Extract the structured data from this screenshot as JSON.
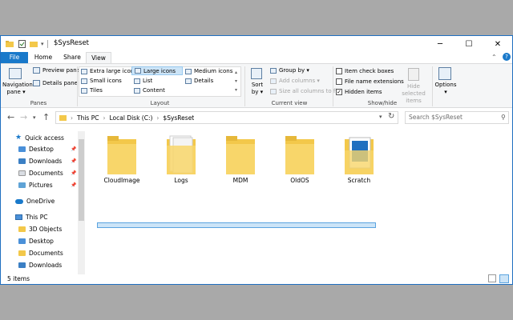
{
  "window": {
    "title": "$SysReset"
  },
  "title_controls": {
    "minimize": "─",
    "maximize": "☐",
    "close": "✕"
  },
  "tabs": {
    "file": "File",
    "home": "Home",
    "share": "Share",
    "view": "View"
  },
  "ribbon": {
    "panes": {
      "navigation_pane": "Navigation",
      "navigation_pane_2": "pane ▾",
      "preview_pane": "Preview pane",
      "details_pane": "Details pane",
      "label": "Panes"
    },
    "layout": {
      "extra_large": "Extra large icons",
      "large": "Large icons",
      "medium": "Medium icons",
      "small": "Small icons",
      "list": "List",
      "details": "Details",
      "tiles": "Tiles",
      "content": "Content",
      "label": "Layout",
      "selected": "Large icons"
    },
    "current_view": {
      "sort_by": "Sort",
      "sort_by_2": "by ▾",
      "group_by": "Group by ▾",
      "add_columns": "Add columns ▾",
      "size_columns": "Size all columns to fit",
      "label": "Current view"
    },
    "show_hide": {
      "item_check_boxes": "Item check boxes",
      "file_name_extensions": "File name extensions",
      "hidden_items": "Hidden items",
      "hidden_items_checked": true,
      "hide_selected": "Hide selected",
      "hide_selected_2": "items",
      "label": "Show/hide"
    },
    "options": {
      "label": "Options",
      "caret": "▾"
    }
  },
  "address": {
    "crumbs": [
      "This PC",
      "Local Disk (C:)",
      "$SysReset"
    ],
    "separator": "›",
    "search_placeholder": "Search $SysReset"
  },
  "sidebar": {
    "quick_access": "Quick access",
    "quick_items": [
      "Desktop",
      "Downloads",
      "Documents",
      "Pictures"
    ],
    "onedrive": "OneDrive",
    "this_pc": "This PC",
    "pc_items": [
      "3D Objects",
      "Desktop",
      "Documents",
      "Downloads"
    ]
  },
  "folders": [
    "CloudImage",
    "Logs",
    "MDM",
    "OldOS",
    "Scratch"
  ],
  "status": {
    "count": "5 items"
  },
  "colors": {
    "accent": "#1979ca",
    "folder": "#f3c84a",
    "selection": "#cce4f7"
  }
}
